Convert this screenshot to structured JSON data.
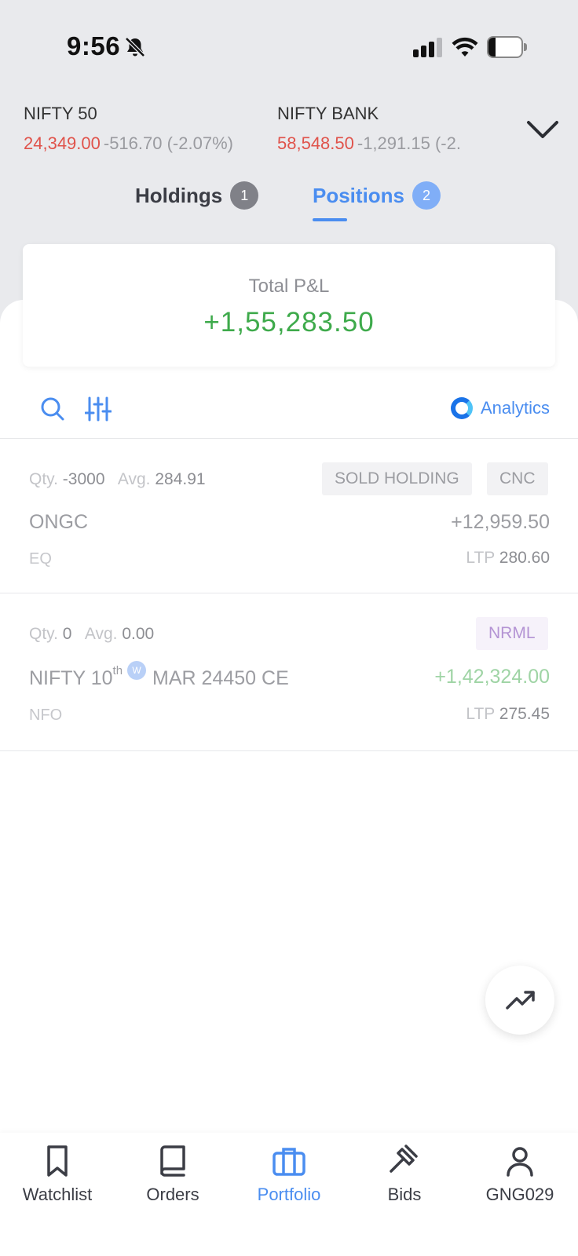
{
  "status_bar": {
    "time": "9:56",
    "battery": "21",
    "battery_level": 0.21
  },
  "indices": [
    {
      "name": "NIFTY 50",
      "price": "24,349.00",
      "change": "-516.70 (-2.07%)"
    },
    {
      "name": "NIFTY BANK",
      "price": "58,548.50",
      "change": "-1,291.15 (-2."
    }
  ],
  "tabs": [
    {
      "label": "Holdings",
      "count": "1"
    },
    {
      "label": "Positions",
      "count": "2"
    }
  ],
  "summary": {
    "label": "Total P&L",
    "value": "+1,55,283.50"
  },
  "toolbar": {
    "analytics_label": "Analytics"
  },
  "positions": [
    {
      "qty_label": "Qty.",
      "qty": "-3000",
      "avg_label": "Avg.",
      "avg": "284.91",
      "badges": [
        "SOLD HOLDING",
        "CNC"
      ],
      "symbol": "ONGC",
      "segment": "EQ",
      "pnl": "+12,959.50",
      "ltp_label": "LTP",
      "ltp": "280.60",
      "pnl_color": "#9c9da2"
    },
    {
      "qty_label": "Qty.",
      "qty": "0",
      "avg_label": "Avg.",
      "avg": "0.00",
      "badges": [
        "NRML"
      ],
      "symbol_pre": "NIFTY 10",
      "symbol_sup": "th",
      "weekly_badge": "W",
      "symbol_post": "MAR 24450 CE",
      "segment": "NFO",
      "pnl": "+1,42,324.00",
      "ltp_label": "LTP",
      "ltp": "275.45",
      "pnl_color": "#9fd4a5"
    }
  ],
  "bottom_nav": [
    {
      "label": "Watchlist",
      "icon": "bookmark-icon"
    },
    {
      "label": "Orders",
      "icon": "book-icon"
    },
    {
      "label": "Portfolio",
      "icon": "briefcase-icon",
      "active": true
    },
    {
      "label": "Bids",
      "icon": "gavel-icon"
    },
    {
      "label": "GNG029",
      "icon": "user-icon"
    }
  ],
  "colors": {
    "accent": "#4a8df0",
    "loss": "#e0534b",
    "profit": "#3eaa4b"
  }
}
